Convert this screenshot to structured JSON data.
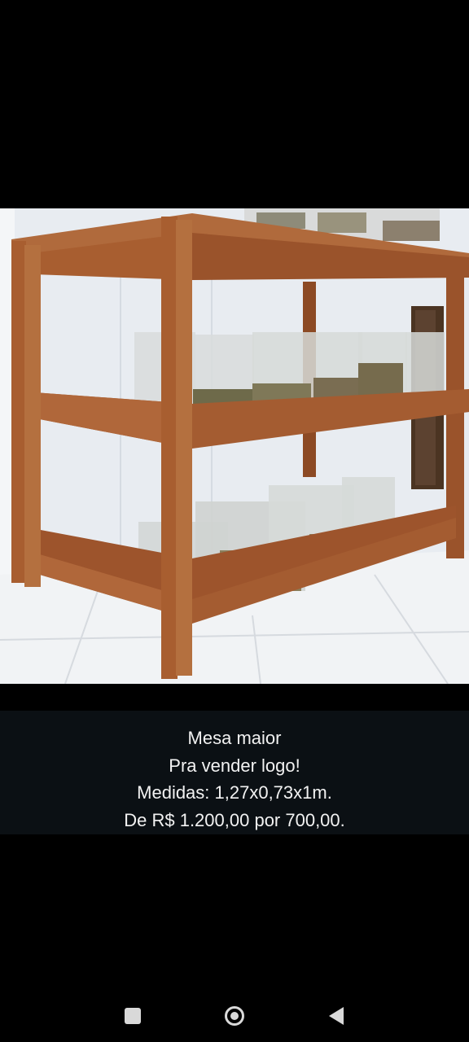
{
  "post": {
    "caption_lines": [
      "Mesa maior",
      "Pra vender logo!",
      "Medidas: 1,27x0,73x1m.",
      "De R$ 1.200,00 por 700,00."
    ]
  },
  "navigation": {
    "recents_icon": "square-recents-icon",
    "home_icon": "circle-home-icon",
    "back_icon": "triangle-back-icon"
  },
  "colors": {
    "background": "#000000",
    "caption_band": "#0b1014",
    "wood": "#a0582e"
  }
}
